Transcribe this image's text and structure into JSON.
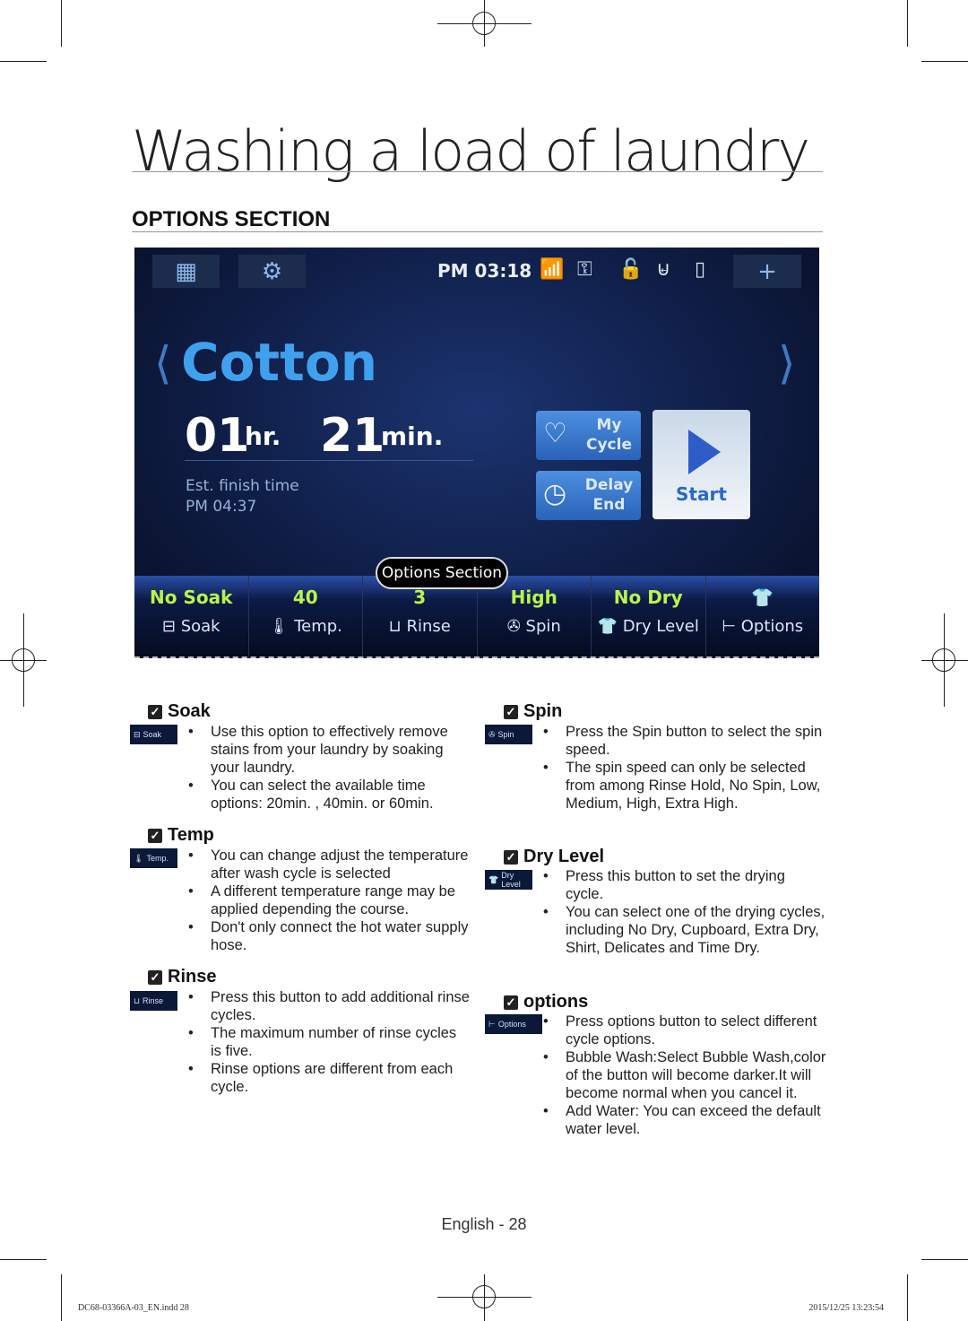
{
  "page": {
    "title": "Washing a load of laundry",
    "section": "OPTIONS SECTION",
    "footer": "English - 28",
    "slug_left": "DC68-03366A-03_EN.indd   28",
    "slug_right": "2015/12/25   13:23:54"
  },
  "screen": {
    "clock": "PM 03:18",
    "cycle": "Cotton",
    "hours": "01",
    "hr_unit": "hr.",
    "minutes": "21",
    "min_unit": "min.",
    "est_label": "Est. finish time",
    "est_time": "PM 04:37",
    "my_cycle": "My Cycle",
    "delay_end": "Delay End",
    "start": "Start",
    "bubble": "Options Section",
    "options": [
      {
        "value": "No Soak",
        "label": "Soak",
        "icon": "soak-icon"
      },
      {
        "value": "40",
        "label": "Temp.",
        "icon": "thermometer-icon"
      },
      {
        "value": "3",
        "label": "Rinse",
        "icon": "rinse-icon"
      },
      {
        "value": "High",
        "label": "Spin",
        "icon": "spin-icon"
      },
      {
        "value": "No Dry",
        "label": "Dry Level",
        "icon": "shirt-icon"
      },
      {
        "value": "",
        "label": "Options",
        "icon": "options-icon"
      }
    ],
    "accent": "#3fa1ee",
    "value_color": "#b9f54a"
  },
  "sections": {
    "soak": {
      "title": "Soak",
      "badge": "Soak",
      "bullets": [
        "Use this option to effectively remove stains from your laundry by soaking your laundry.",
        "You can select the available time options: 20min. , 40min. or 60min."
      ]
    },
    "temp": {
      "title": "Temp",
      "badge": "Temp.",
      "bullets": [
        "You can change adjust the temperature after wash cycle is selected",
        "A different temperature range may be applied depending the course.",
        "Don't only connect the hot water supply hose."
      ]
    },
    "rinse": {
      "title": "Rinse",
      "badge": "Rinse",
      "bullets": [
        "Press this button to add additional rinse cycles.",
        "The maximum number of rinse cycles is five.",
        "Rinse options are different from each cycle."
      ]
    },
    "spin": {
      "title": "Spin",
      "badge": "Spin",
      "bullets": [
        "Press the Spin button to select the spin speed.",
        "The spin speed can only be selected from among Rinse Hold, No Spin, Low, Medium, High, Extra High."
      ]
    },
    "dry": {
      "title": "Dry Level",
      "badge": "Dry Level",
      "bullets": [
        "Press this button to set the drying cycle.",
        "You can select one of the drying cycles, including No Dry, Cupboard, Extra Dry, Shirt, Delicates and Time Dry."
      ]
    },
    "options": {
      "title": "options",
      "badge": "Options",
      "bullets": [
        "Press options button to select different cycle options.",
        "Bubble Wash:Select Bubble Wash,color of the button will become darker.It will become normal when you cancel it.",
        "Add Water: You can exceed the default water level."
      ]
    }
  }
}
